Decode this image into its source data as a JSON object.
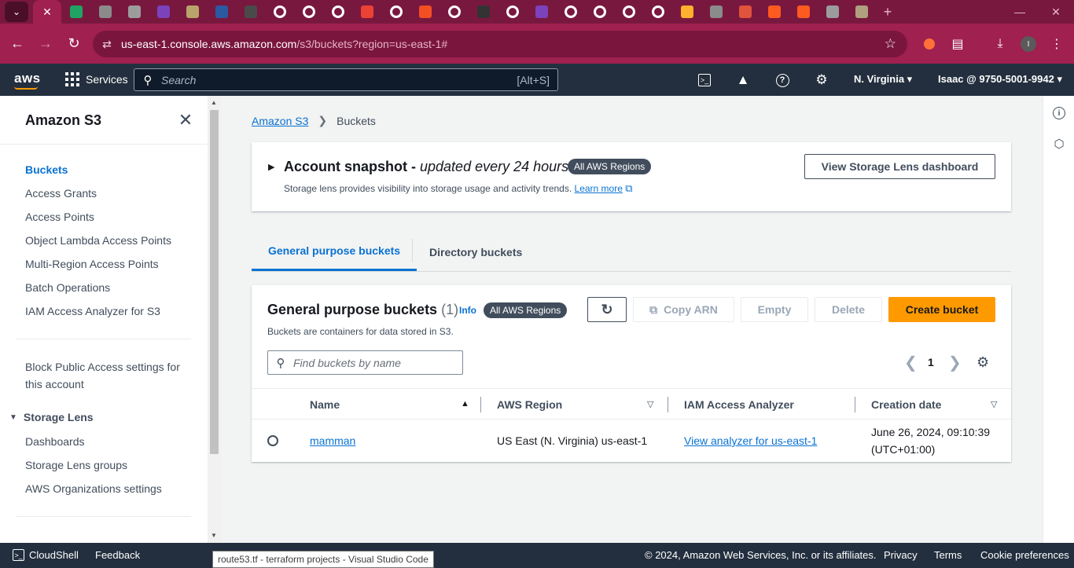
{
  "browser": {
    "tab_colors": [
      "#1fa463",
      "#8b8b8b",
      "#9c9c9c",
      "#7b42bc",
      "#b8a36a",
      "#2c5aa0",
      "#4a4a4a",
      "#ffffff",
      "#ffffff",
      "#ffffff",
      "#ea4335",
      "#ffffff",
      "#f25022",
      "#ffffff",
      "#333333",
      "#ffffff",
      "#7b42bc",
      "#ffffff",
      "#ffffff",
      "#ffffff",
      "#ffffff",
      "#ffb02e",
      "#8b8b8b",
      "#e0533c",
      "#ff5a1f",
      "#ff5a1f",
      "#9c9c9c",
      "#b0a080"
    ],
    "url_host": "us-east-1.console.aws.amazon.com",
    "url_path": "/s3/buckets?region=us-east-1#",
    "profile_initial": "I"
  },
  "aws_nav": {
    "logo": "aws",
    "services_label": "Services",
    "search_placeholder": "Search",
    "search_shortcut": "[Alt+S]",
    "region": "N. Virginia",
    "account": "Isaac @ 9750-5001-9942"
  },
  "sidebar": {
    "title": "Amazon S3",
    "items": [
      "Buckets",
      "Access Grants",
      "Access Points",
      "Object Lambda Access Points",
      "Multi-Region Access Points",
      "Batch Operations",
      "IAM Access Analyzer for S3"
    ],
    "block_public_line1": "Block Public Access settings for",
    "block_public_line2": "this account",
    "storage_lens_section": "Storage Lens",
    "storage_lens_items": [
      "Dashboards",
      "Storage Lens groups",
      "AWS Organizations settings"
    ]
  },
  "breadcrumb": {
    "root": "Amazon S3",
    "current": "Buckets"
  },
  "snapshot": {
    "title": "Account snapshot - ",
    "subtitle": "updated every 24 hours",
    "badge": "All AWS Regions",
    "description": "Storage lens provides visibility into storage usage and activity trends. ",
    "learn_more": "Learn more",
    "dashboard_button": "View Storage Lens dashboard"
  },
  "tabs": [
    "General purpose buckets",
    "Directory buckets"
  ],
  "buckets_panel": {
    "title": "General purpose buckets",
    "count": "(1)",
    "info": "Info",
    "badge": "All AWS Regions",
    "description": "Buckets are containers for data stored in S3.",
    "copy_arn": "Copy ARN",
    "empty": "Empty",
    "delete": "Delete",
    "create": "Create bucket",
    "find_placeholder": "Find buckets by name",
    "page": "1",
    "columns": [
      "Name",
      "AWS Region",
      "IAM Access Analyzer",
      "Creation date"
    ],
    "rows": [
      {
        "name": "mamman",
        "region": "US East (N. Virginia) us-east-1",
        "analyzer": "View analyzer for us-east-1",
        "created_line1": "June 26, 2024, 09:10:39",
        "created_line2": "(UTC+01:00)"
      }
    ]
  },
  "footer": {
    "cloudshell": "CloudShell",
    "feedback": "Feedback",
    "copyright": "© 2024, Amazon Web Services, Inc. or its affiliates.",
    "privacy": "Privacy",
    "terms": "Terms",
    "cookie": "Cookie preferences"
  },
  "tooltip": "route53.tf - terraform projects - Visual Studio Code"
}
